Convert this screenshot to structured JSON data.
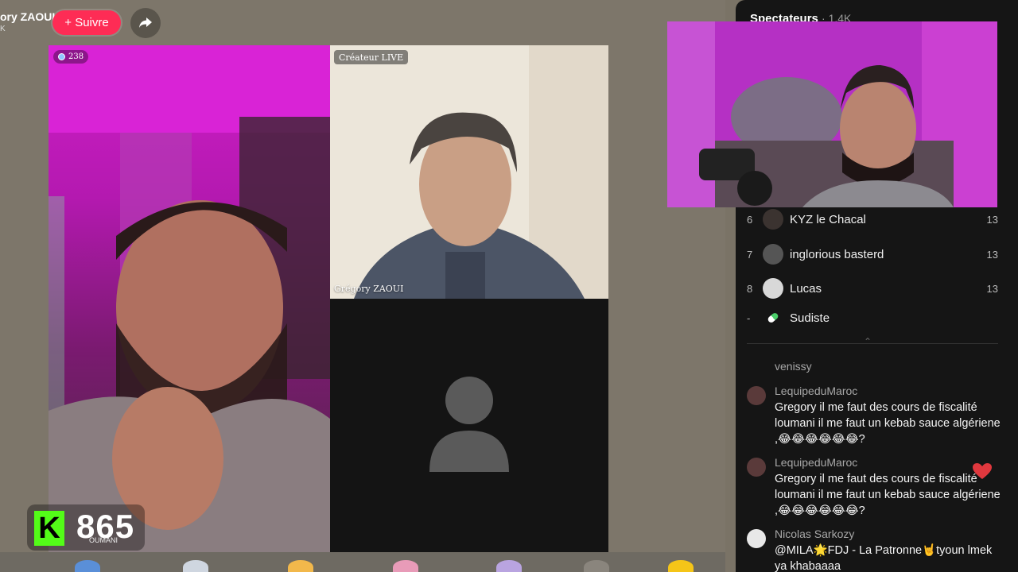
{
  "header": {
    "host_name": "ory ZAOUI",
    "host_sub": "K",
    "follow_label": "+ Suivre"
  },
  "tiles": {
    "left_viewers": "238",
    "top_right_badge": "Créateur LIVE",
    "top_right_name": "Grégory ZAOUI"
  },
  "kick": {
    "logo": "K",
    "count": "865",
    "under_label": "OUMANI"
  },
  "panel": {
    "title": "Spectateurs",
    "count": "· 1,4K",
    "viewers": [
      {
        "rank": "6",
        "name": "KYZ le Chacal",
        "score": "13"
      },
      {
        "rank": "7",
        "name": "inglorious basterd",
        "score": "13"
      },
      {
        "rank": "8",
        "name": "Lucas",
        "score": "13"
      },
      {
        "rank": "-",
        "name": "Sudiste",
        "score": ""
      }
    ],
    "partial_user": "venissy",
    "chat": [
      {
        "user": "LequipeduMaroc",
        "text": "Gregory il me faut des cours de fiscalité loumani il me faut un kebab sauce algériene ,😂😂😂😂😂😂?"
      },
      {
        "user": "LequipeduMaroc",
        "text": "Gregory il me faut des cours de fiscalité loumani il me faut un kebab sauce algériene ,😂😂😂😂😂😂?"
      },
      {
        "user": "Nicolas Sarkozy",
        "text": "@MILA🌟FDJ - La Patronne🤘tyoun lmek ya khabaaaa"
      }
    ]
  },
  "colors": {
    "follow": "#fe2c55",
    "kick_green": "#53fc18",
    "panel_bg": "#151515",
    "heart": "#e0383e"
  }
}
